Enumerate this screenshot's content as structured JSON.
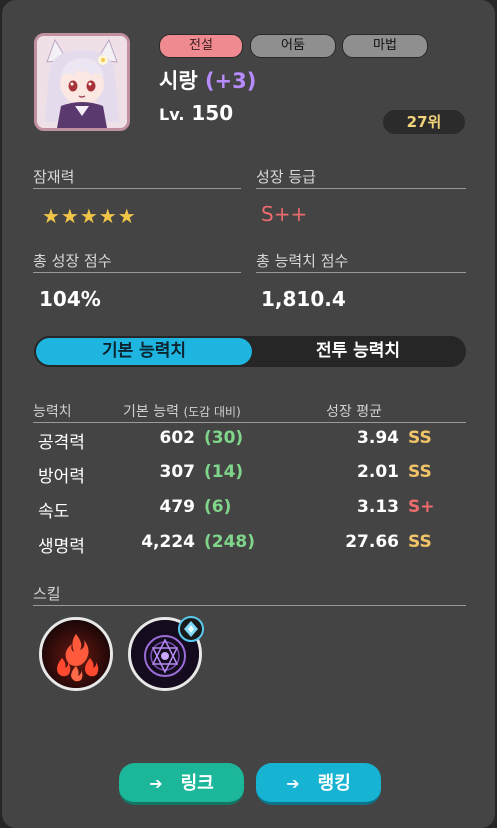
{
  "character": {
    "name": "시랑",
    "enhance": "(+3)",
    "level_label": "Lv.",
    "level": "150",
    "rank": "27위",
    "tags": [
      "전설",
      "어둠",
      "마법"
    ]
  },
  "potential": {
    "label": "잠재력",
    "stars": 5,
    "stars_text": "★★★★★"
  },
  "growth_grade": {
    "label": "성장 등급",
    "value": "S++"
  },
  "total_growth": {
    "label": "총 성장 점수",
    "value": "104%"
  },
  "total_stats": {
    "label": "총 능력치 점수",
    "value": "1,810.4"
  },
  "tabs": {
    "basic": "기본 능력치",
    "combat": "전투 능력치",
    "active": "basic"
  },
  "stats_table": {
    "headers": {
      "stat": "능력치",
      "base": "기본 능력",
      "base_sub": "(도감 대비)",
      "avg": "성장 평균"
    },
    "rows": [
      {
        "name": "공격력",
        "base": "602",
        "diff": "(30)",
        "avg": "3.94",
        "grade": "SS"
      },
      {
        "name": "방어력",
        "base": "307",
        "diff": "(14)",
        "avg": "2.01",
        "grade": "SS"
      },
      {
        "name": "속도",
        "base": "479",
        "diff": "(6)",
        "avg": "3.13",
        "grade": "S+"
      },
      {
        "name": "생명력",
        "base": "4,224",
        "diff": "(248)",
        "avg": "27.66",
        "grade": "SS"
      }
    ]
  },
  "skills": {
    "label": "스킬",
    "items": [
      {
        "icon": "fire-skill-icon"
      },
      {
        "icon": "dark-magic-circle-skill-icon",
        "badge": "crystal-badge-icon"
      }
    ]
  },
  "buttons": {
    "link": "링크",
    "ranking": "랭킹",
    "arrow": "➔"
  },
  "colors": {
    "legend": "#ef8a90",
    "tag_gray": "#8f8f8f",
    "accent_blue": "#1eb6e0",
    "green_diff": "#7fd68a",
    "grade_ss": "#f2c46a",
    "grade_splus": "#ee6b6e",
    "link_btn": "#1cb79a",
    "rank_btn": "#16b3d3",
    "rank_text": "#f2d27a"
  }
}
